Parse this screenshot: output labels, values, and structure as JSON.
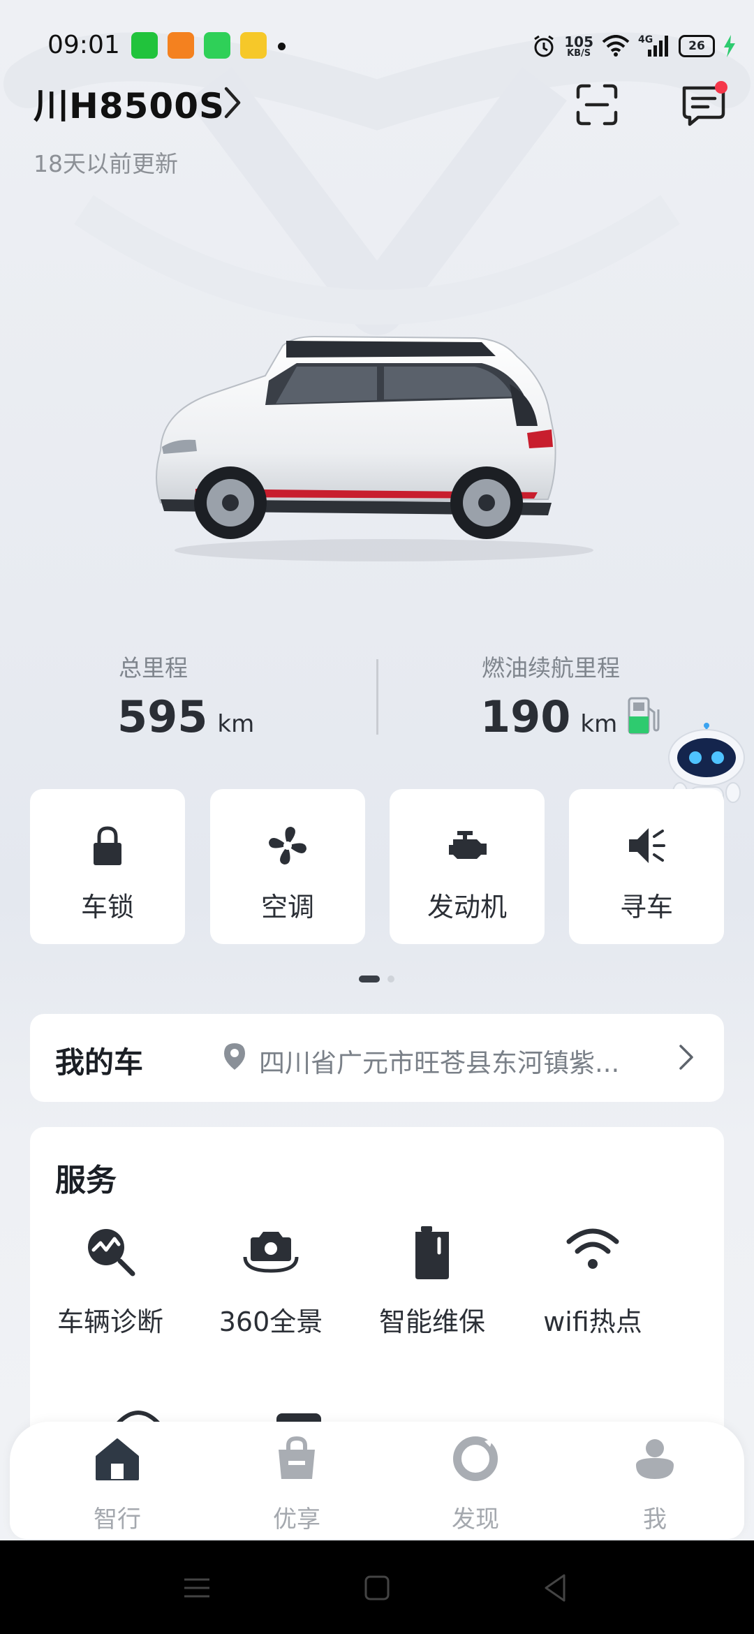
{
  "status_bar": {
    "time": "09:01",
    "net_speed_value": "105",
    "net_speed_unit": "KB/S",
    "network_type": "4G",
    "battery_level": "26"
  },
  "header": {
    "plate": "川H8500S",
    "updated_text": "18天以前更新"
  },
  "stats": {
    "total_mileage_label": "总里程",
    "total_mileage_value": "595",
    "total_mileage_unit": "km",
    "fuel_range_label": "燃油续航里程",
    "fuel_range_value": "190",
    "fuel_range_unit": "km"
  },
  "quick_controls": [
    {
      "label": "车锁",
      "icon": "lock-icon"
    },
    {
      "label": "空调",
      "icon": "fan-icon"
    },
    {
      "label": "发动机",
      "icon": "engine-icon"
    },
    {
      "label": "寻车",
      "icon": "horn-icon"
    }
  ],
  "my_car": {
    "title": "我的车",
    "address": "四川省广元市旺苍县东河镇紫..."
  },
  "services": {
    "title": "服务",
    "items": [
      {
        "label": "车辆诊断",
        "icon": "diagnosis-icon"
      },
      {
        "label": "360全景",
        "icon": "camera-360-icon"
      },
      {
        "label": "智能维保",
        "icon": "maintenance-icon"
      },
      {
        "label": "wifi热点",
        "icon": "wifi-icon"
      }
    ]
  },
  "bottom_nav": [
    {
      "label": "智行",
      "icon": "home-icon"
    },
    {
      "label": "优享",
      "icon": "shopping-bag-icon"
    },
    {
      "label": "发现",
      "icon": "discover-icon"
    },
    {
      "label": "我",
      "icon": "profile-icon"
    }
  ],
  "colors": {
    "accent_green": "#2ecb6f",
    "notification_red": "#f5374a",
    "icon_dark": "#2b2f36",
    "nav_inactive": "#a4a8ae"
  }
}
